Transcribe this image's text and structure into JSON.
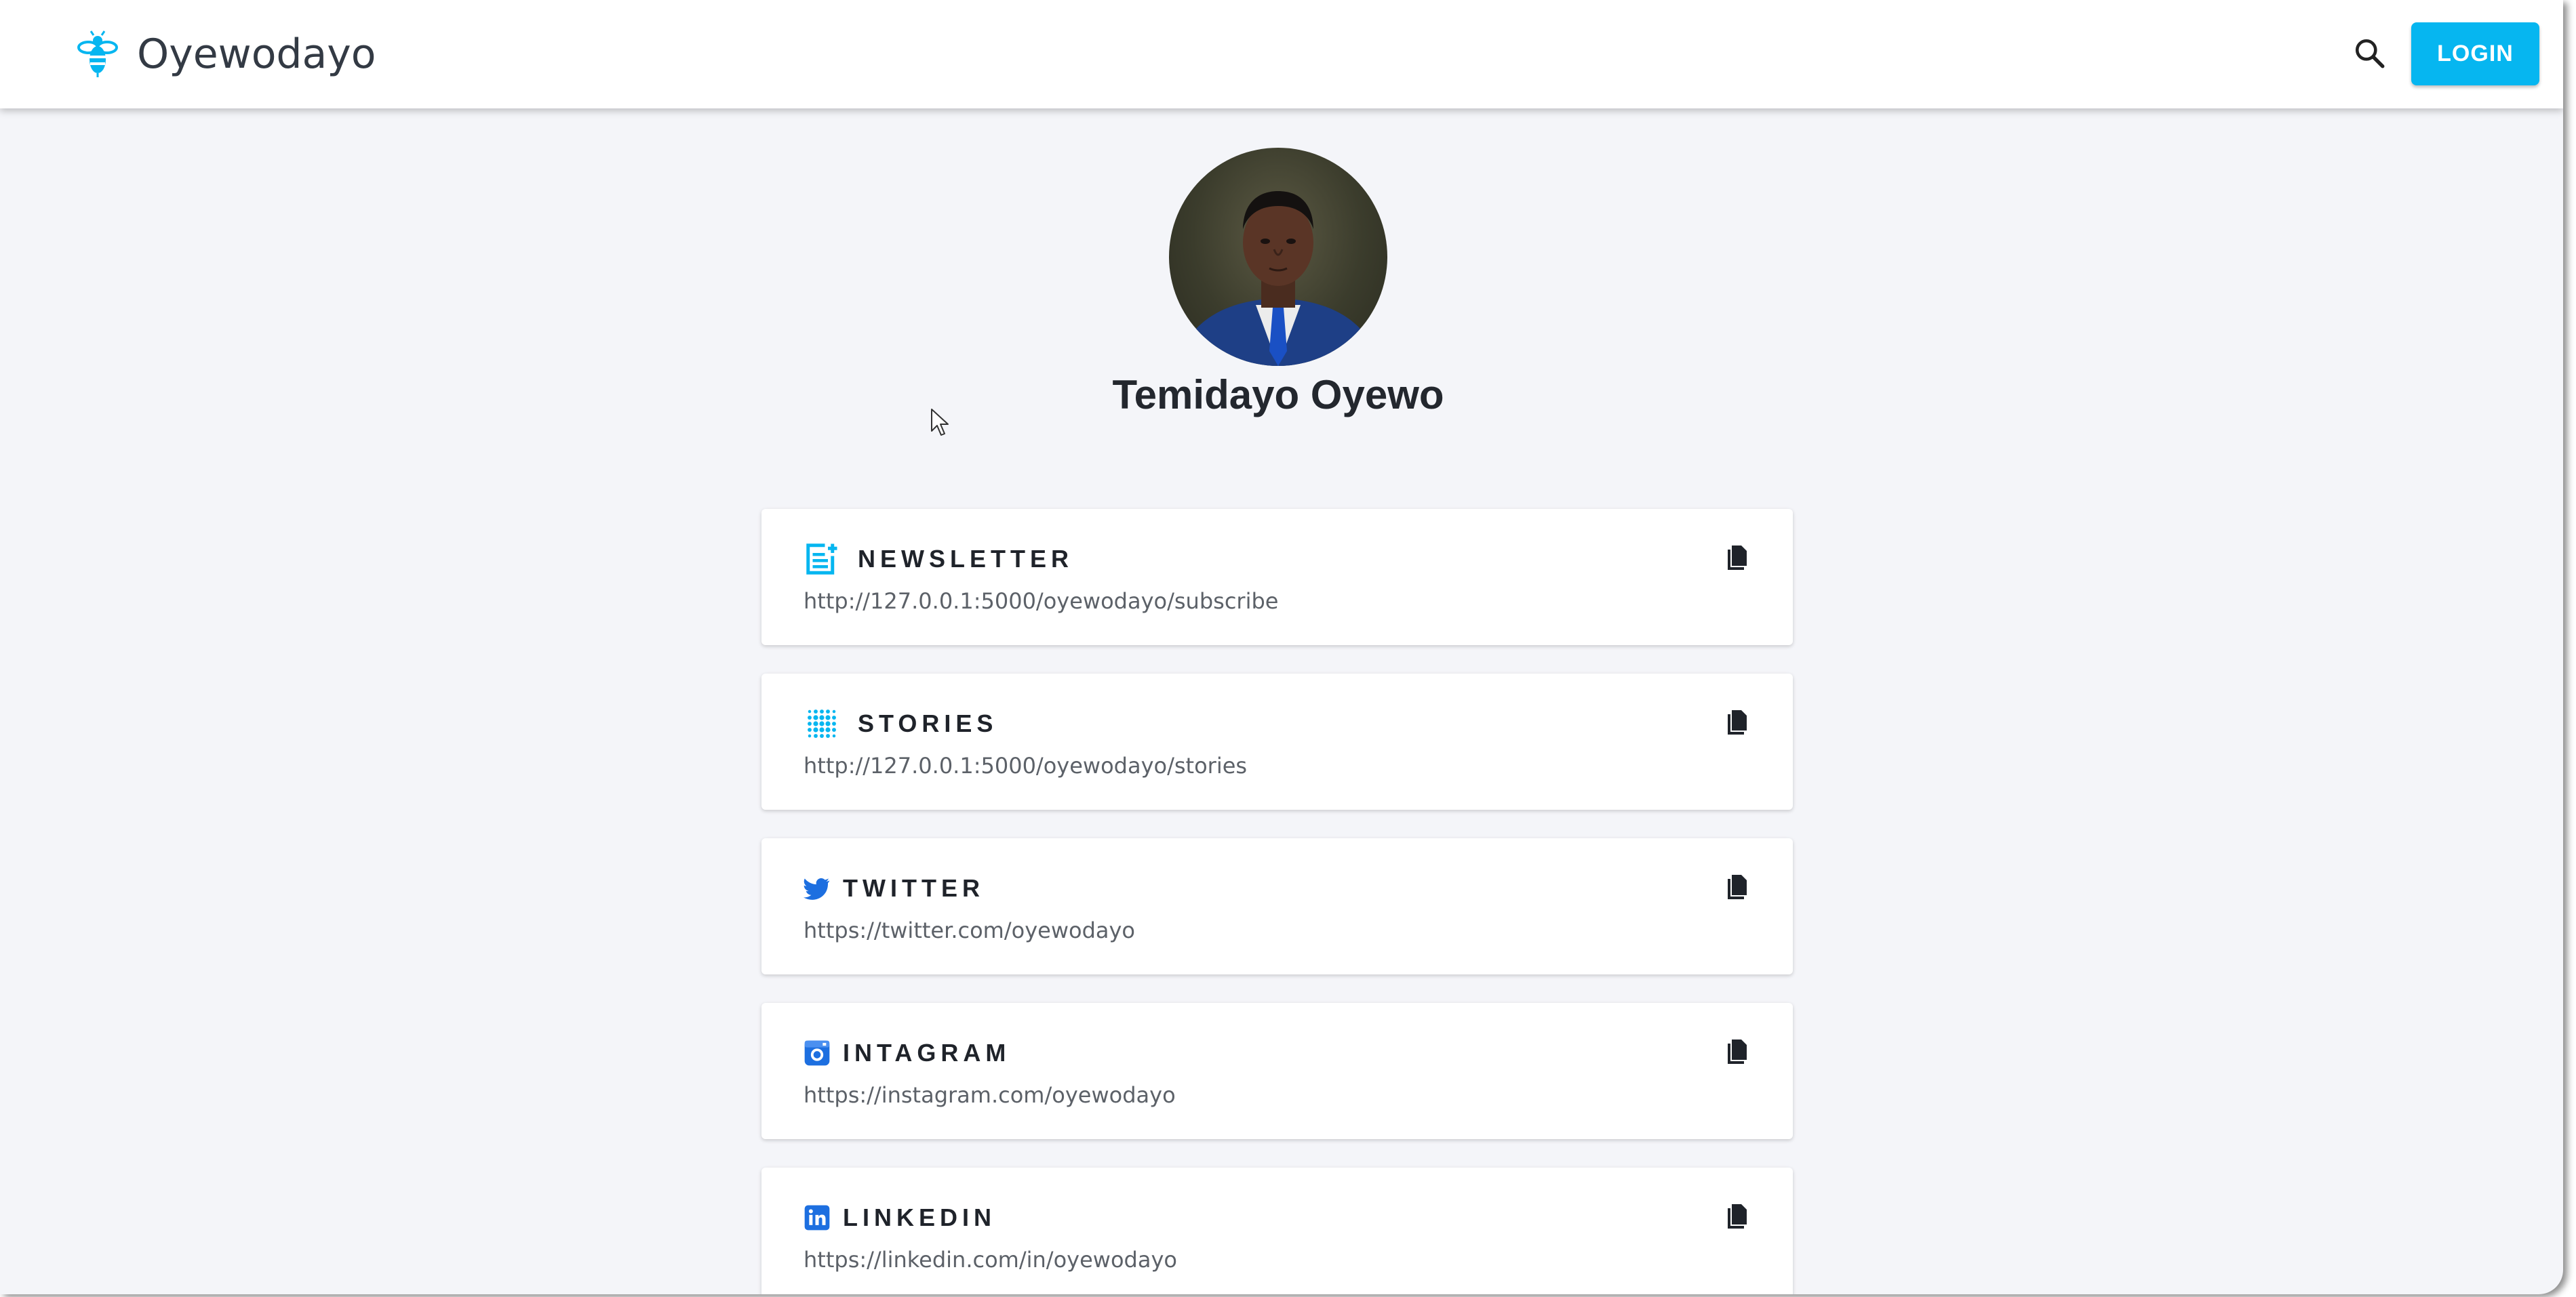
{
  "header": {
    "brand_name": "Oyewodayo",
    "brand_icon": "bee-logo-icon",
    "search_icon": "search-icon",
    "login_label": "LOGIN",
    "accent_color": "#06b6f0"
  },
  "profile": {
    "name": "Temidayo Oyewo"
  },
  "links": [
    {
      "title": "NEWSLETTER",
      "url": "http://127.0.0.1:5000/oyewodayo/subscribe",
      "icon": "newsletter-add-icon",
      "icon_color": "#06b6f0"
    },
    {
      "title": "STORIES",
      "url": "http://127.0.0.1:5000/oyewodayo/stories",
      "icon": "dot-grid-icon",
      "icon_color": "#06b6f0"
    },
    {
      "title": "TWITTER",
      "url": "https://twitter.com/oyewodayo",
      "icon": "twitter-icon",
      "icon_color": "#1d6fe0"
    },
    {
      "title": "INTAGRAM",
      "url": "https://instagram.com/oyewodayo",
      "icon": "instagram-icon",
      "icon_color": "#1d6fe0"
    },
    {
      "title": "LINKEDIN",
      "url": "https://linkedin.com/in/oyewodayo",
      "icon": "linkedin-icon",
      "icon_color": "#1d6fe0"
    }
  ]
}
